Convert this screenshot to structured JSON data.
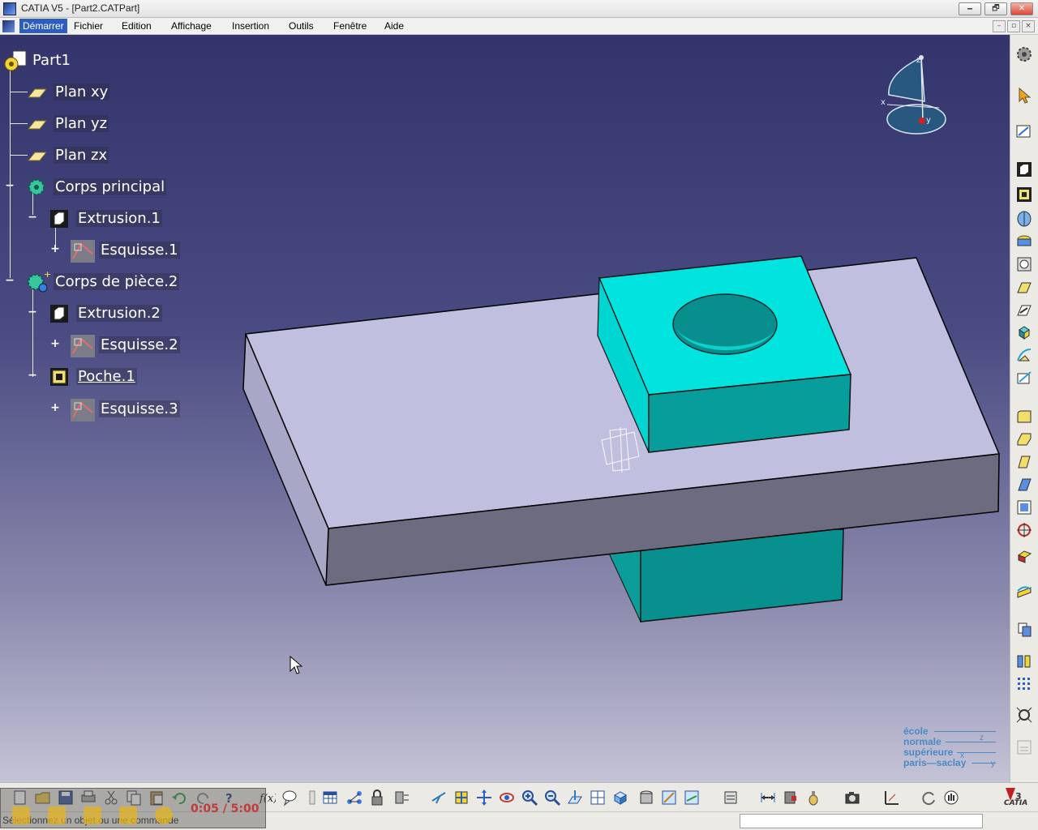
{
  "window": {
    "title": "CATIA V5 - [Part2.CATPart]",
    "minimize": "🗕",
    "restore": "🗗",
    "close": "✕"
  },
  "menu": {
    "items": [
      "Démarrer",
      "Fichier",
      "Edition",
      "Affichage",
      "Insertion",
      "Outils",
      "Fenêtre",
      "Aide"
    ],
    "mdi_min": "–",
    "mdi_restore": "▫",
    "mdi_close": "×"
  },
  "tree": {
    "root": "Part1",
    "items": [
      {
        "label": "Plan xy",
        "icon": "plane-icon"
      },
      {
        "label": "Plan yz",
        "icon": "plane-icon"
      },
      {
        "label": "Plan zx",
        "icon": "plane-icon"
      },
      {
        "label": "Corps principal",
        "icon": "body-icon",
        "toggle": "−"
      },
      {
        "label": "Extrusion.1",
        "icon": "pad-icon",
        "toggle": "−"
      },
      {
        "label": "Esquisse.1",
        "icon": "sketch-icon",
        "toggle": "+"
      },
      {
        "label": "Corps de pièce.2",
        "icon": "body-icon",
        "toggle": "−"
      },
      {
        "label": "Extrusion.2",
        "icon": "pad-icon",
        "toggle": "−"
      },
      {
        "label": "Esquisse.2",
        "icon": "sketch-icon",
        "toggle": "+"
      },
      {
        "label": "Poche.1",
        "icon": "pocket-icon",
        "toggle": "−"
      },
      {
        "label": "Esquisse.3",
        "icon": "sketch-icon",
        "toggle": "+"
      }
    ]
  },
  "compass": {
    "x_label": "x",
    "y_label": "y",
    "z_label": "z"
  },
  "status": {
    "message": "Sélectionnez un objet ou une commande",
    "command_value": ""
  },
  "recorder": {
    "time": "0:05 / 5:00"
  },
  "logo": {
    "line1": "école",
    "line2": "normale",
    "line3": "supérieure",
    "line4": "paris—saclay",
    "axis_z": "z",
    "axis_x": "x",
    "axis_y": "y"
  },
  "brand": {
    "catia": "CATIA"
  },
  "colors": {
    "part_face_top": "#c3c1e3",
    "part_face_side": "#6c6a7e",
    "boss_top": "#00e1dc",
    "boss_side": "#059a98",
    "background_top": "#33346c",
    "background_bottom": "#c4c3d6"
  }
}
